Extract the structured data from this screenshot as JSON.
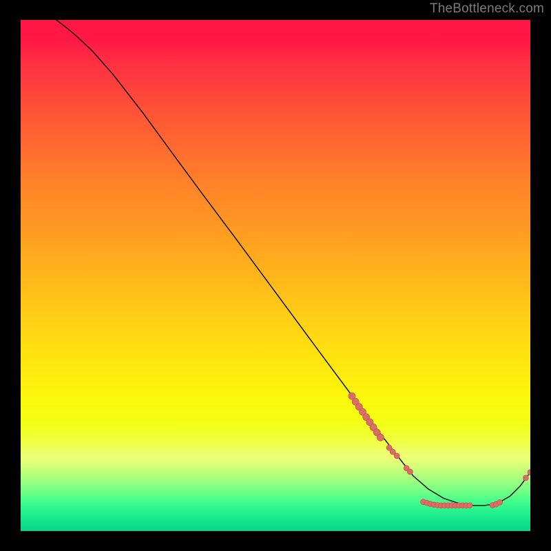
{
  "attribution": "TheBottleneck.com",
  "colors": {
    "background": "#000000",
    "attribution_text": "#7b7b7b",
    "curve": "#000000",
    "dot_fill": "#d86e66",
    "dot_stroke": "#c95850"
  },
  "chart_data": {
    "type": "line",
    "title": "",
    "xlabel": "",
    "ylabel": "",
    "xlim": [
      0,
      100
    ],
    "ylim": [
      0,
      100
    ],
    "series": [
      {
        "name": "bottleneck-curve",
        "x": [
          7,
          9,
          11,
          14,
          18,
          24,
          30,
          36,
          42,
          48,
          54,
          60,
          65,
          70,
          74,
          77,
          80,
          83,
          86,
          89,
          91,
          93.5,
          96,
          98,
          100
        ],
        "y": [
          100,
          98.5,
          96.8,
          94,
          89.5,
          81.8,
          73.6,
          65.5,
          57.5,
          49.4,
          41.3,
          33.2,
          26.5,
          19.8,
          14.6,
          10.8,
          8.2,
          6.4,
          5.4,
          5.0,
          5.0,
          5.4,
          6.8,
          8.8,
          11.5
        ]
      }
    ],
    "scatter_clusters": [
      {
        "name": "highlight-dots",
        "points": [
          {
            "x": 65.0,
            "y": 26.4,
            "r": 5
          },
          {
            "x": 65.7,
            "y": 25.3,
            "r": 5
          },
          {
            "x": 66.4,
            "y": 24.3,
            "r": 5
          },
          {
            "x": 67.1,
            "y": 23.3,
            "r": 5
          },
          {
            "x": 67.8,
            "y": 22.3,
            "r": 5
          },
          {
            "x": 68.5,
            "y": 21.3,
            "r": 5
          },
          {
            "x": 69.2,
            "y": 20.3,
            "r": 5
          },
          {
            "x": 69.9,
            "y": 19.3,
            "r": 5
          },
          {
            "x": 70.6,
            "y": 18.3,
            "r": 5
          },
          {
            "x": 72.3,
            "y": 16.3,
            "r": 4
          },
          {
            "x": 73.0,
            "y": 15.5,
            "r": 4
          },
          {
            "x": 73.8,
            "y": 14.7,
            "r": 4
          },
          {
            "x": 75.7,
            "y": 12.3,
            "r": 4
          },
          {
            "x": 76.4,
            "y": 11.6,
            "r": 4
          },
          {
            "x": 79.0,
            "y": 5.7,
            "r": 4
          },
          {
            "x": 79.7,
            "y": 5.5,
            "r": 4
          },
          {
            "x": 80.4,
            "y": 5.3,
            "r": 4
          },
          {
            "x": 81.1,
            "y": 5.15,
            "r": 4
          },
          {
            "x": 81.8,
            "y": 5.05,
            "r": 4
          },
          {
            "x": 82.5,
            "y": 5.0,
            "r": 4
          },
          {
            "x": 83.2,
            "y": 5.0,
            "r": 4
          },
          {
            "x": 83.9,
            "y": 5.0,
            "r": 4
          },
          {
            "x": 84.6,
            "y": 5.0,
            "r": 4
          },
          {
            "x": 85.3,
            "y": 5.0,
            "r": 4
          },
          {
            "x": 86.0,
            "y": 5.0,
            "r": 4
          },
          {
            "x": 86.7,
            "y": 5.0,
            "r": 4
          },
          {
            "x": 87.4,
            "y": 5.0,
            "r": 4
          },
          {
            "x": 88.1,
            "y": 5.0,
            "r": 4
          },
          {
            "x": 92.6,
            "y": 5.05,
            "r": 4
          },
          {
            "x": 93.3,
            "y": 5.25,
            "r": 4
          },
          {
            "x": 94.0,
            "y": 5.6,
            "r": 4
          },
          {
            "x": 99.1,
            "y": 10.4,
            "r": 4
          },
          {
            "x": 100.0,
            "y": 11.5,
            "r": 4
          }
        ]
      }
    ],
    "gradient_stops": [
      {
        "pct": 0,
        "color": "#ff1846"
      },
      {
        "pct": 20,
        "color": "#ff5a34"
      },
      {
        "pct": 44,
        "color": "#ffa31f"
      },
      {
        "pct": 66,
        "color": "#ffe40f"
      },
      {
        "pct": 82,
        "color": "#f0ff3a"
      },
      {
        "pct": 92,
        "color": "#6dff85"
      },
      {
        "pct": 100,
        "color": "#06d688"
      }
    ]
  }
}
